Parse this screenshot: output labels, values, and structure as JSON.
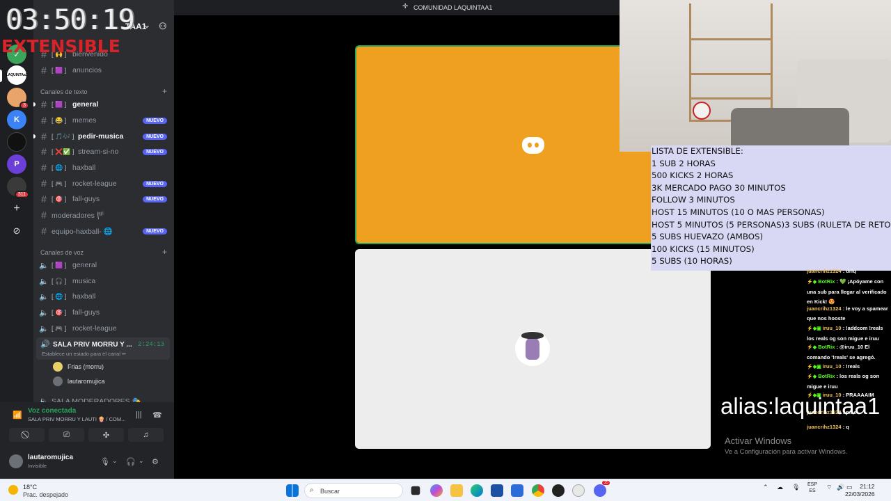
{
  "overlay": {
    "timer": "03:50:19",
    "extensible_label": "EXTENSIBLE"
  },
  "window": {
    "title": "COMUNIDAD LAQUINTAA1"
  },
  "server": {
    "name_fragment": "TAA1"
  },
  "server_rail": {
    "server_label": "LAQUINTAa1",
    "badge_1": "3",
    "badge_2": "311"
  },
  "channels": {
    "top_items": [
      {
        "emoji": "[ 🙌 ]",
        "label": "bienvenido"
      },
      {
        "emoji": "[ 🟪 ]",
        "label": "anuncios"
      }
    ],
    "text_category": "Canales de texto",
    "text": [
      {
        "emoji": "[ 🟪 ]",
        "label": "general",
        "active": true,
        "new": ""
      },
      {
        "emoji": "[ 😂 ]",
        "label": "memes",
        "active": false,
        "new": "NUEVO"
      },
      {
        "emoji": "[ 🎵🎶 ]",
        "label": "pedir-musica",
        "active": true,
        "new": "NUEVO"
      },
      {
        "emoji": "[ ❌✅ ]",
        "label": "stream-si-no",
        "active": false,
        "new": "NUEVO"
      },
      {
        "emoji": "[ 🌐 ]",
        "label": "haxball",
        "active": false,
        "new": ""
      },
      {
        "emoji": "[ 🎮 ]",
        "label": "rocket-league",
        "active": false,
        "new": "NUEVO"
      },
      {
        "emoji": "[ 🎯 ]",
        "label": "fall-guys",
        "active": false,
        "new": "NUEVO"
      },
      {
        "emoji": "",
        "label": "moderadores 🏴",
        "active": false,
        "new": ""
      },
      {
        "emoji": "",
        "label": "equipo-haxball- 🌐",
        "active": false,
        "new": "NUEVO"
      }
    ],
    "voice_category": "Canales de voz",
    "voice": [
      {
        "emoji": "[ 🟪 ]",
        "label": "general"
      },
      {
        "emoji": "[ 🎧 ]",
        "label": "musica"
      },
      {
        "emoji": "[ 🌐 ]",
        "label": "haxball"
      },
      {
        "emoji": "[ 🎯 ]",
        "label": "fall-guys"
      },
      {
        "emoji": "[ 🎮 ]",
        "label": "rocket-league"
      }
    ],
    "active_voice": {
      "name": "SALA PRIV MORRU Y ...",
      "time": "2:24:13",
      "status_prompt": "Establece un estado para el canal ✏"
    },
    "voice_users": [
      "Frias (morru)",
      "lautaromujica"
    ],
    "next_voice": "SALA MODERADORES 🎭"
  },
  "voice_panel": {
    "status": "Voz conectada",
    "channel": "SALA PRIV MORRU Y LAUTI 🍿 / COM..."
  },
  "user": {
    "name": "lautaromujica",
    "status": "Invisible"
  },
  "extensible_list": [
    "LISTA DE EXTENSIBLE:",
    "1 SUB 2 HORAS",
    "500 KICKS 2 HORAS",
    "3K MERCADO PAGO 30 MINUTOS",
    "FOLLOW 3 MINUTOS",
    "HOST 15 MINUTOS (10 O MAS PERSONAS)",
    "HOST 5 MINUTOS (5 PERSONAS)3 SUBS (RULETA DE RETOS)",
    "5 SUBS HUEVAZO (AMBOS)",
    "100 KICKS (15 MINUTOS)",
    "5 SUBS (10 HORAS)"
  ],
  "chat": [
    {
      "user": "juancrihz1324",
      "text": ": drfq"
    },
    {
      "user": "BotRix",
      "bot": true,
      "text": ": 💚 ¡Apóyame con una sub para llegar al verificado en Kick! 😍"
    },
    {
      "user": "juancrihz1324",
      "text": ": le voy a spamear que nos hooste"
    },
    {
      "user": "iruu_10",
      "text": ": !addcom !reals los reals og son migue e iruu"
    },
    {
      "user": "BotRix",
      "bot": true,
      "text": ": @iruu_10 El comando '!reals' se agregó."
    },
    {
      "user": "iruu_10",
      "text": ": !reals"
    },
    {
      "user": "BotRix",
      "bot": true,
      "text": ": los reals og son migue e iruu"
    },
    {
      "user": "iruu_10",
      "text": ": PRAAAAIM"
    },
    {
      "user": "juancrihz1324",
      "text": ": pn,e"
    },
    {
      "user": "juancrihz1324",
      "text": ": q"
    }
  ],
  "alias": "alias:laquintaa1",
  "activation": {
    "title": "Activar Windows",
    "subtitle": "Ve a Configuración para activar Windows."
  },
  "taskbar": {
    "temp": "18°C",
    "condition": "Prac. despejado",
    "search_placeholder": "Buscar",
    "lang_1": "ESP",
    "lang_2": "ES",
    "time": "21:12",
    "date": "22/03/2026",
    "discord_badge": "35"
  }
}
